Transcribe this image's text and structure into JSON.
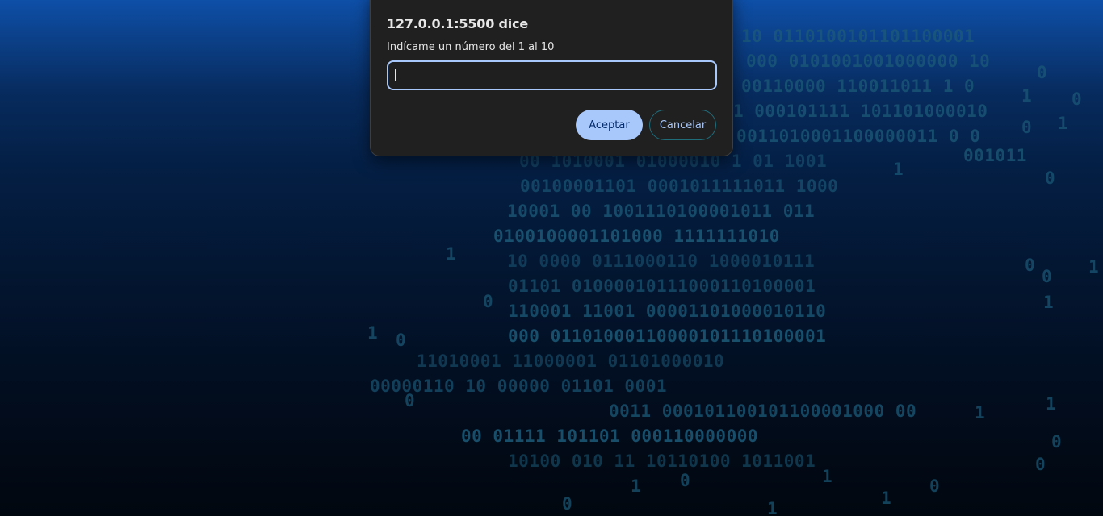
{
  "dialog": {
    "title": "127.0.0.1:5500 dice",
    "message": "Indícame un número del 1 al 10",
    "input_value": "",
    "accept_label": "Aceptar",
    "cancel_label": "Cancelar"
  },
  "background": {
    "top_color": "#0e4fa8",
    "bottom_color": "#01070f",
    "digit_color": "#1c5a78",
    "binary_lines": [
      "00 1010001 01000010  1 01 1001",
      "00100001101 0001011111011 1000",
      "10001 00 1001110100001011 011",
      "0100100001101000  1111111010",
      "10 0000 0111000110 1000010111",
      "01101 01000010111000110100001",
      "110001 11001 00001101000010110",
      "000 01101000110000101110100001",
      "11010001 11000001 01101000010",
      "00000110  10  00000 01101 0001",
      "0011 000101100101100001000 00",
      "00 01111  101101 000110000000",
      "10100 010 11 10110100 1011001"
    ],
    "upper_lines": [
      "10 0110100101101100001",
      "000 0101001001000000 10",
      "00110000 110011011 1 0",
      "1 000101111  101101000010",
      "0011010001100000011 0 0",
      "001011"
    ],
    "scattered_digits": [
      "0",
      "1",
      "0",
      "0",
      "1",
      "1",
      "0",
      "1",
      "0",
      "0",
      "1",
      "0",
      "1",
      "1",
      "0",
      "0",
      "1",
      "1",
      "0",
      "0",
      "1",
      "0",
      "1",
      "1",
      "0",
      "0",
      "1"
    ]
  }
}
